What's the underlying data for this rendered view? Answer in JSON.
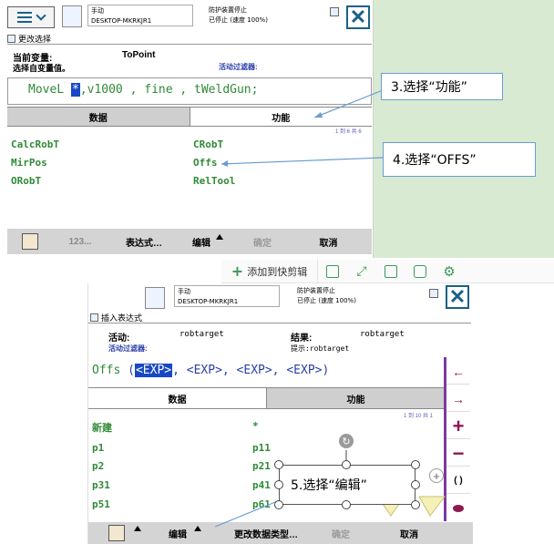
{
  "top": {
    "status": {
      "mode": "手动",
      "system": "DESKTOP-MKRKJR1",
      "safety": "防护装置停止",
      "state": "已停止 (速度 100%)"
    },
    "window_title": "更改选择",
    "current_var_label": "当前变量:",
    "current_var_value": "ToPoint",
    "choose_label": "选择自变量值。",
    "active_filter_label": "活动过滤器:",
    "code": {
      "pre": "MoveL ",
      "sel": "*",
      "post": ",v1000 , fine , tWeldGun;"
    },
    "tabs": {
      "data": "数据",
      "function": "功能"
    },
    "page_info": "1 到 6 共 6",
    "items": [
      "CalcRobT",
      "CRobT",
      "MirPos",
      "Offs",
      "ORobT",
      "RelTool"
    ],
    "toolbar": {
      "num": "123...",
      "expr": "表达式…",
      "edit": "编辑",
      "ok": "确定",
      "cancel": "取消"
    },
    "callouts": {
      "function": "3.选择“功能”",
      "offs": "4.选择“OFFS”"
    }
  },
  "floatbar": {
    "add_label": "添加到快剪辑"
  },
  "bottom": {
    "status": {
      "mode": "手动",
      "system": "DESKTOP-MKRKJR1",
      "safety": "防护装置停止",
      "state": "已停止 (速度 100%)"
    },
    "window_title": "插入表达式",
    "active_label": "活动:",
    "active_value": "robtarget",
    "result_label": "结果:",
    "result_value": "robtarget",
    "active_filter_label": "活动过滤器:",
    "hint": "提示:robtarget",
    "expr": {
      "func": "Offs",
      "open": " (",
      "arg1": "<EXP>",
      "rest": ", <EXP>, <EXP>, <EXP>)"
    },
    "tabs": {
      "data": "数据",
      "function": "功能"
    },
    "page_info": "1 到 10 共 1",
    "items": [
      "新建",
      "*",
      "p1",
      "p11",
      "p2",
      "p21",
      "p31",
      "p41",
      "p51",
      "p61"
    ],
    "side_buttons": [
      "←",
      "→",
      "+",
      "−",
      "( )"
    ],
    "toolbar": {
      "edit": "编辑",
      "change_type": "更改数据类型…",
      "ok": "确定",
      "cancel": "取消"
    },
    "callout": "5.选择“编辑”"
  },
  "colors": {
    "accent": "#1c5f88",
    "item_green": "#2f8a36",
    "selection_blue": "#1848c4",
    "sidebar_purple": "#7b3aa4",
    "callout_border": "#6a9ccf"
  }
}
